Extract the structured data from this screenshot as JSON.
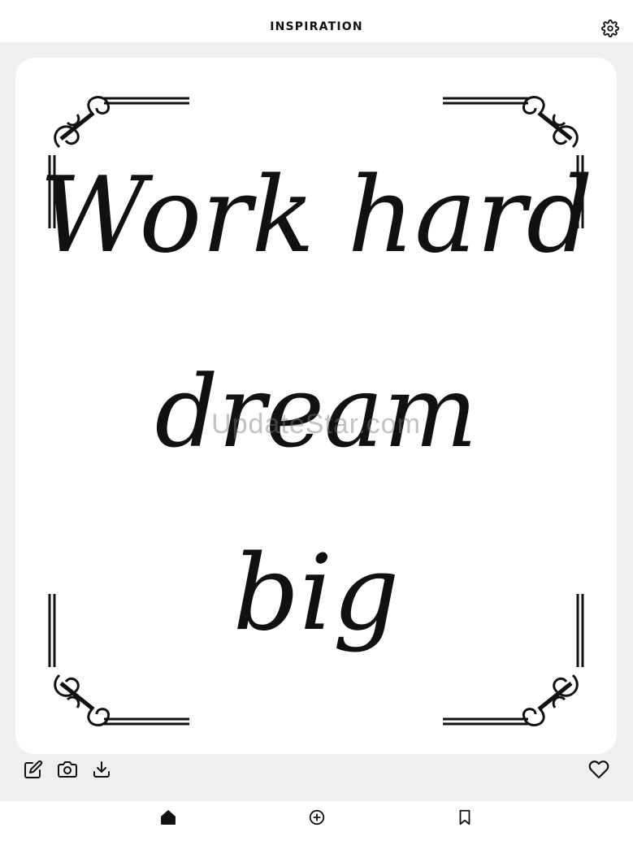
{
  "header": {
    "title": "INSPIRATION",
    "settings_icon": "gear-icon"
  },
  "card": {
    "quote_lines": [
      "Work hard",
      "dream",
      "big"
    ],
    "watermark": "UpdateStar.com",
    "ornament_color": "#111111"
  },
  "actions": {
    "left": [
      "edit-icon",
      "camera-icon",
      "download-icon"
    ],
    "right": "heart-icon"
  },
  "bottom_nav": [
    "home-icon",
    "add-circle-icon",
    "bookmark-icon"
  ]
}
